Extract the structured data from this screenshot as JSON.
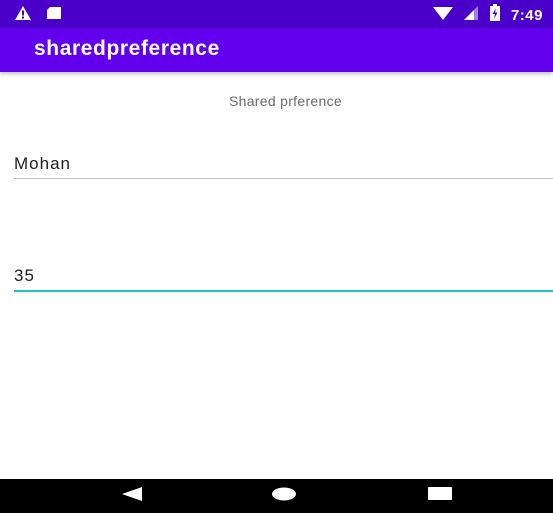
{
  "status_bar": {
    "time": "7:49",
    "icons": [
      "warning-icon",
      "sd-card-icon",
      "wifi-icon",
      "cell-signal-icon",
      "battery-icon"
    ]
  },
  "app_bar": {
    "title": "sharedpreference",
    "color": "#6200ee"
  },
  "main": {
    "heading": "Shared prference",
    "name_field": {
      "value": "Mohan"
    },
    "age_field": {
      "value": "35"
    },
    "accent_color": "#1ec6be"
  },
  "nav_bar": {
    "icons": [
      "back-icon",
      "home-icon",
      "recents-icon"
    ]
  }
}
